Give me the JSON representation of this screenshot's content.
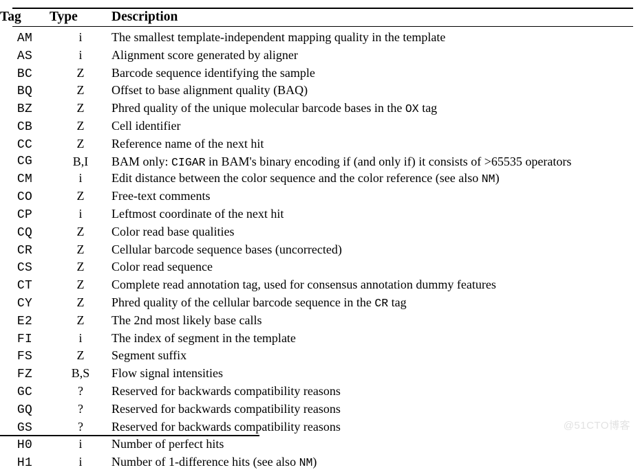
{
  "document": {
    "kind": "specification-table",
    "watermark": "@51CTO博客"
  },
  "table": {
    "columns": {
      "tag": "Tag",
      "type": "Type",
      "description": "Description"
    },
    "rows": [
      {
        "tag": "AM",
        "type": "i",
        "desc_parts": [
          {
            "text": "The smallest template-independent mapping quality in the template",
            "mono": false
          }
        ]
      },
      {
        "tag": "AS",
        "type": "i",
        "desc_parts": [
          {
            "text": "Alignment score generated by aligner",
            "mono": false
          }
        ]
      },
      {
        "tag": "BC",
        "type": "Z",
        "desc_parts": [
          {
            "text": "Barcode sequence identifying the sample",
            "mono": false
          }
        ]
      },
      {
        "tag": "BQ",
        "type": "Z",
        "desc_parts": [
          {
            "text": "Offset to base alignment quality (BAQ)",
            "mono": false
          }
        ]
      },
      {
        "tag": "BZ",
        "type": "Z",
        "desc_parts": [
          {
            "text": "Phred quality of the unique molecular barcode bases in the ",
            "mono": false
          },
          {
            "text": "OX",
            "mono": true
          },
          {
            "text": " tag",
            "mono": false
          }
        ]
      },
      {
        "tag": "CB",
        "type": "Z",
        "desc_parts": [
          {
            "text": "Cell identifier",
            "mono": false
          }
        ]
      },
      {
        "tag": "CC",
        "type": "Z",
        "desc_parts": [
          {
            "text": "Reference name of the next hit",
            "mono": false
          }
        ]
      },
      {
        "tag": "CG",
        "type": "B,I",
        "tall": true,
        "justify": true,
        "desc_parts": [
          {
            "text": "BAM only: ",
            "mono": false
          },
          {
            "text": "CIGAR",
            "mono": true
          },
          {
            "text": " in BAM's binary encoding if (and only if) it consists of >65535 operators",
            "mono": false
          }
        ]
      },
      {
        "tag": "CM",
        "type": "i",
        "desc_parts": [
          {
            "text": "Edit distance between the color sequence and the color reference (see also ",
            "mono": false
          },
          {
            "text": "NM",
            "mono": true
          },
          {
            "text": ")",
            "mono": false
          }
        ]
      },
      {
        "tag": "CO",
        "type": "Z",
        "desc_parts": [
          {
            "text": "Free-text comments",
            "mono": false
          }
        ]
      },
      {
        "tag": "CP",
        "type": "i",
        "desc_parts": [
          {
            "text": "Leftmost coordinate of the next hit",
            "mono": false
          }
        ]
      },
      {
        "tag": "CQ",
        "type": "Z",
        "desc_parts": [
          {
            "text": "Color read base qualities",
            "mono": false
          }
        ]
      },
      {
        "tag": "CR",
        "type": "Z",
        "desc_parts": [
          {
            "text": "Cellular barcode sequence bases (uncorrected)",
            "mono": false
          }
        ]
      },
      {
        "tag": "CS",
        "type": "Z",
        "desc_parts": [
          {
            "text": "Color read sequence",
            "mono": false
          }
        ]
      },
      {
        "tag": "CT",
        "type": "Z",
        "desc_parts": [
          {
            "text": "Complete read annotation tag, used for consensus annotation dummy features",
            "mono": false
          }
        ]
      },
      {
        "tag": "CY",
        "type": "Z",
        "desc_parts": [
          {
            "text": "Phred quality of the cellular barcode sequence in the ",
            "mono": false
          },
          {
            "text": "CR",
            "mono": true
          },
          {
            "text": " tag",
            "mono": false
          }
        ]
      },
      {
        "tag": "E2",
        "type": "Z",
        "desc_parts": [
          {
            "text": "The 2nd most likely base calls",
            "mono": false
          }
        ]
      },
      {
        "tag": "FI",
        "type": "i",
        "desc_parts": [
          {
            "text": "The index of segment in the template",
            "mono": false
          }
        ]
      },
      {
        "tag": "FS",
        "type": "Z",
        "desc_parts": [
          {
            "text": "Segment suffix",
            "mono": false
          }
        ]
      },
      {
        "tag": "FZ",
        "type": "B,S",
        "desc_parts": [
          {
            "text": "Flow signal intensities",
            "mono": false
          }
        ]
      },
      {
        "tag": "GC",
        "type": "?",
        "desc_parts": [
          {
            "text": "Reserved for backwards compatibility reasons",
            "mono": false
          }
        ]
      },
      {
        "tag": "GQ",
        "type": "?",
        "desc_parts": [
          {
            "text": "Reserved for backwards compatibility reasons",
            "mono": false
          }
        ]
      },
      {
        "tag": "GS",
        "type": "?",
        "desc_parts": [
          {
            "text": "Reserved for backwards compatibility reasons",
            "mono": false
          }
        ]
      },
      {
        "tag": "H0",
        "type": "i",
        "desc_parts": [
          {
            "text": "Number of perfect hits",
            "mono": false
          }
        ]
      },
      {
        "tag": "H1",
        "type": "i",
        "desc_parts": [
          {
            "text": "Number of 1-difference hits (see also ",
            "mono": false
          },
          {
            "text": "NM",
            "mono": true
          },
          {
            "text": ")",
            "mono": false
          }
        ]
      }
    ]
  }
}
